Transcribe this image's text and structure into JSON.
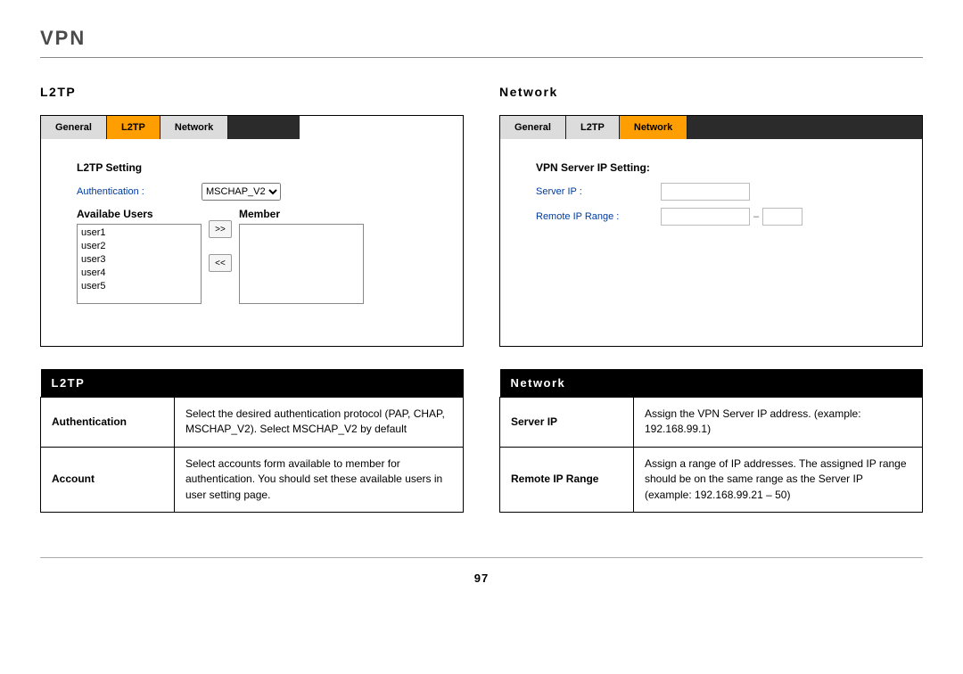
{
  "page": {
    "title": "VPN",
    "number": "97"
  },
  "left": {
    "label": "L2TP",
    "shot": {
      "tabs": {
        "general": "General",
        "l2tp": "L2TP",
        "network": "Network"
      },
      "settingTitle": "L2TP Setting",
      "authLabel": "Authentication :",
      "authValue": "MSCHAP_V2",
      "availableHead": "Availabe Users",
      "memberHead": "Member",
      "users": [
        "user1",
        "user2",
        "user3",
        "user4",
        "user5"
      ]
    },
    "table": {
      "banner": "L2TP",
      "rows": [
        {
          "key": "Authentication",
          "val": "Select the desired authentication protocol (PAP, CHAP, MSCHAP_V2). Select MSCHAP_V2 by default"
        },
        {
          "key": "Account",
          "val": "Select accounts form available to member for authentication. You should set these available users in user setting page."
        }
      ]
    }
  },
  "right": {
    "label": "Network",
    "shot": {
      "tabs": {
        "general": "General",
        "l2tp": "L2TP",
        "network": "Network"
      },
      "settingTitle": "VPN Server IP Setting:",
      "serverIpLabel": "Server IP :",
      "remoteLabel": "Remote IP Range :"
    },
    "table": {
      "banner": "Network",
      "rows": [
        {
          "key": "Server IP",
          "val": "Assign the VPN Server  IP address. (example: 192.168.99.1)"
        },
        {
          "key": "Remote IP Range",
          "val": "Assign a range of IP addresses. The assigned IP range should be on the same range as the Server IP (example: 192.168.99.21 – 50)"
        }
      ]
    }
  }
}
